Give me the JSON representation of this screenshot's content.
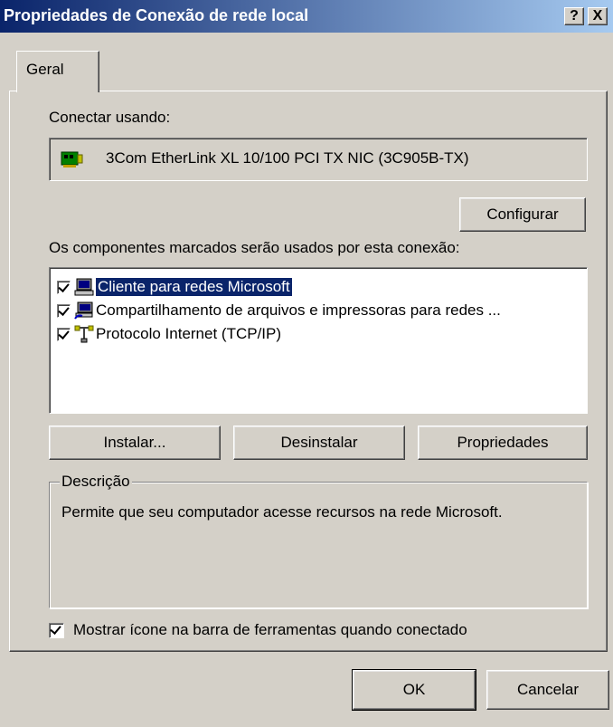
{
  "window": {
    "title": "Propriedades de Conexão de rede local",
    "help_button": "?",
    "close_button": "X"
  },
  "tabs": [
    {
      "label": "Geral"
    }
  ],
  "connect_using": {
    "label": "Conectar usando:",
    "adapter": "3Com EtherLink XL 10/100 PCI TX NIC (3C905B-TX)",
    "configure_button": "Configurar"
  },
  "components": {
    "label": "Os componentes marcados serão usados por esta conexão:",
    "items": [
      {
        "label": "Cliente para redes Microsoft",
        "checked": true,
        "selected": true,
        "icon": "computer-icon"
      },
      {
        "label": "Compartilhamento de arquivos e impressoras para redes ...",
        "checked": true,
        "selected": false,
        "icon": "shared-computer-icon"
      },
      {
        "label": "Protocolo Internet (TCP/IP)",
        "checked": true,
        "selected": false,
        "icon": "network-protocol-icon"
      }
    ],
    "install_button": "Instalar...",
    "uninstall_button": "Desinstalar",
    "properties_button": "Propriedades"
  },
  "description": {
    "legend": "Descrição",
    "text": "Permite que seu computador acesse recursos na rede Microsoft."
  },
  "show_icon": {
    "label": "Mostrar ícone na barra de ferramentas quando conectado",
    "checked": true
  },
  "footer": {
    "ok_button": "OK",
    "cancel_button": "Cancelar"
  },
  "colors": {
    "titlebar_start": "#0a246a",
    "titlebar_end": "#a6caf0",
    "face": "#d4d0c8",
    "selection": "#0a246a"
  }
}
